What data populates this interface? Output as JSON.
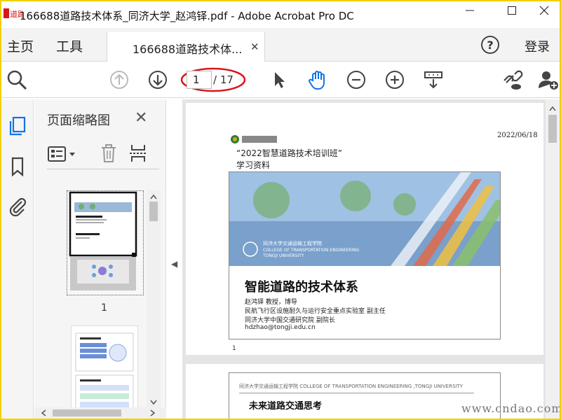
{
  "window": {
    "title": "166688道路技术体系_同济大学_赵鸿铎.pdf - Adobe Acrobat Pro DC",
    "logo_text": "道路"
  },
  "menubar": {
    "home": "主页",
    "tools": "工具",
    "doc_tab_label": "166688道路技术体...",
    "login": "登录"
  },
  "toolbar": {
    "current_page": "1",
    "total_pages": "/ 17"
  },
  "thumbnail_panel": {
    "title": "页面缩略图",
    "thumbnail_1_number": "1"
  },
  "document": {
    "page1": {
      "date": "2022/06/18",
      "course_line1": "“2022智慧道路技术培训班”",
      "course_line2": "学习资料",
      "banner_text_1": "同济大学交通运输工程学院",
      "banner_text_2": "COLLEGE OF TRANSPORTATION ENGINEERING",
      "banner_text_3": "TONGJI UNIVERSITY",
      "slide_title": "智能道路的技术体系",
      "author_lines": [
        "赵鸿铎  教授，博导",
        "民航飞行区设施耐久与运行安全重点实验室 副主任",
        "同济大学中国交通研究院 副院长",
        "hdzhao@tongji.edu.cn"
      ],
      "page_number": "1"
    },
    "page2": {
      "header": "同济大学交通运输工程学院    COLLEGE OF TRANSPORTATION ENGINEERING ,TONGJI UNIVERSITY",
      "slide_title": "未来道路交通思考"
    }
  },
  "watermark": "www.cndao.com",
  "colors": {
    "accent_blue": "#1473e6",
    "highlight_red": "#d8161b",
    "frame_yellow": "#f0d000"
  }
}
